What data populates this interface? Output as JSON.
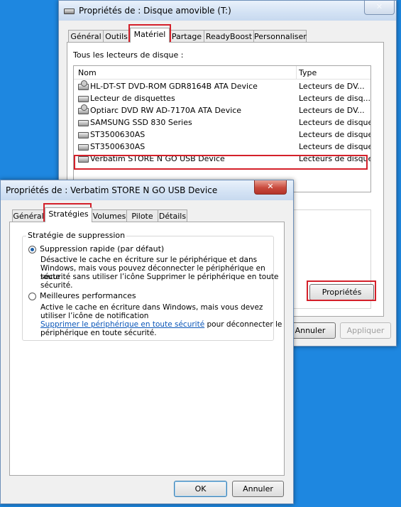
{
  "back_window": {
    "title": "Propriétés de : Disque amovible (T:)",
    "tabs": [
      "Général",
      "Outils",
      "Matériel",
      "Partage",
      "ReadyBoost",
      "Personnaliser"
    ],
    "section_label": "Tous les lecteurs de disque :",
    "columns": {
      "name": "Nom",
      "type": "Type"
    },
    "devices": [
      {
        "name": "HL-DT-ST DVD-ROM GDR8164B ATA Device",
        "type": "Lecteurs de DV...",
        "icon": "optical-drive-icon"
      },
      {
        "name": "Lecteur de disquettes",
        "type": "Lecteurs de disq...",
        "icon": "floppy-drive-icon"
      },
      {
        "name": "Optiarc DVD RW AD-7170A ATA Device",
        "type": "Lecteurs de DV...",
        "icon": "optical-drive-icon"
      },
      {
        "name": "SAMSUNG SSD 830 Series",
        "type": "Lecteurs de disque",
        "icon": "disk-drive-icon"
      },
      {
        "name": "ST3500630AS",
        "type": "Lecteurs de disque",
        "icon": "disk-drive-icon"
      },
      {
        "name": "ST3500630AS",
        "type": "Lecteurs de disque",
        "icon": "disk-drive-icon"
      },
      {
        "name": "Verbatim STORE N GO USB Device",
        "type": "Lecteurs de disque",
        "icon": "usb-drive-icon"
      }
    ],
    "properties_button": "Propriétés",
    "cancel_button": "Annuler",
    "apply_button": "Appliquer"
  },
  "front_window": {
    "title": "Propriétés de : Verbatim STORE N GO USB Device",
    "tabs": [
      "Général",
      "Stratégies",
      "Volumes",
      "Pilote",
      "Détails"
    ],
    "group_label": "Stratégie de suppression",
    "option1_label": "Suppression rapide (par défaut)",
    "option1_desc": [
      "Désactive le cache en écriture sur le périphérique et dans",
      "Windows, mais vous pouvez déconnecter le périphérique en toute",
      "sécurité sans utiliser l’icône Supprimer le périphérique en toute",
      "sécurité."
    ],
    "option2_label": "Meilleures performances",
    "option2_desc": [
      "Active le cache en écriture dans Windows, mais vous devez",
      "utiliser l’icône de notification"
    ],
    "link_text": "Supprimer le périphérique en toute sécurité",
    "after_link": " pour déconnecter le",
    "last_line": "périphérique en toute sécurité.",
    "ok_button": "OK",
    "cancel_button": "Annuler"
  },
  "colors": {
    "desktop": "#1e87e0",
    "highlight": "#d4202a",
    "link": "#0a56b8",
    "close_button": "#c94a3d"
  }
}
